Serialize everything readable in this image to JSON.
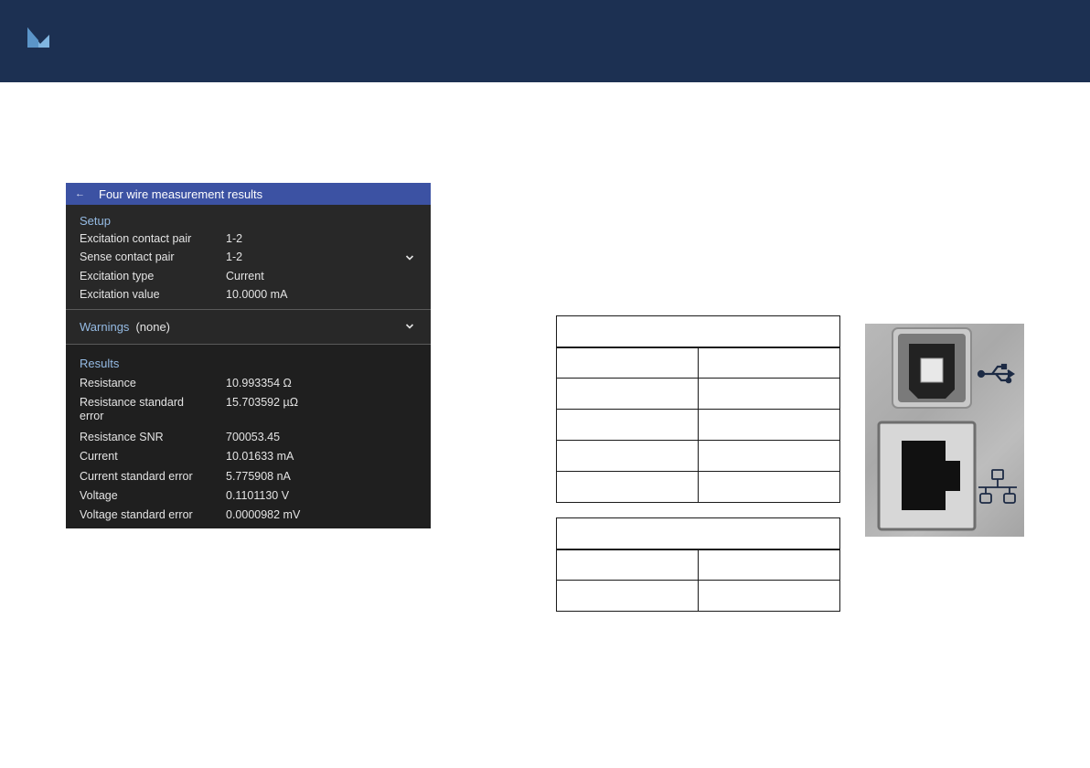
{
  "header": {
    "logo_icon": "brand-logo-icon",
    "bg_color": "#1c3052"
  },
  "screen": {
    "title": "Four wire measurement results",
    "back_icon": "back-arrow-icon",
    "setup": {
      "heading": "Setup",
      "rows": [
        {
          "label": "Excitation contact pair",
          "value": "1-2"
        },
        {
          "label": "Sense contact pair",
          "value": "1-2"
        },
        {
          "label": "Excitation type",
          "value": "Current"
        },
        {
          "label": "Excitation value",
          "value": "10.0000 mA"
        }
      ]
    },
    "warnings": {
      "label": "Warnings",
      "value": "(none)"
    },
    "results": {
      "heading": "Results",
      "rows": [
        {
          "label": "Resistance",
          "value": "10.993354 Ω"
        },
        {
          "label": "Resistance standard error",
          "value": "15.703592 µΩ"
        },
        {
          "label": "Resistance SNR",
          "value": "700053.45"
        },
        {
          "label": "Current",
          "value": "10.01633 mA"
        },
        {
          "label": "Current standard error",
          "value": "5.775908 nA"
        },
        {
          "label": "Voltage",
          "value": "0.1101130 V"
        },
        {
          "label": "Voltage standard error",
          "value": "0.0000982 mV"
        }
      ]
    },
    "accent_color": "#3c52a3",
    "heading_color": "#95bbe4"
  },
  "ports": {
    "usb_icon": "usb-icon",
    "network_icon": "network-icon"
  }
}
